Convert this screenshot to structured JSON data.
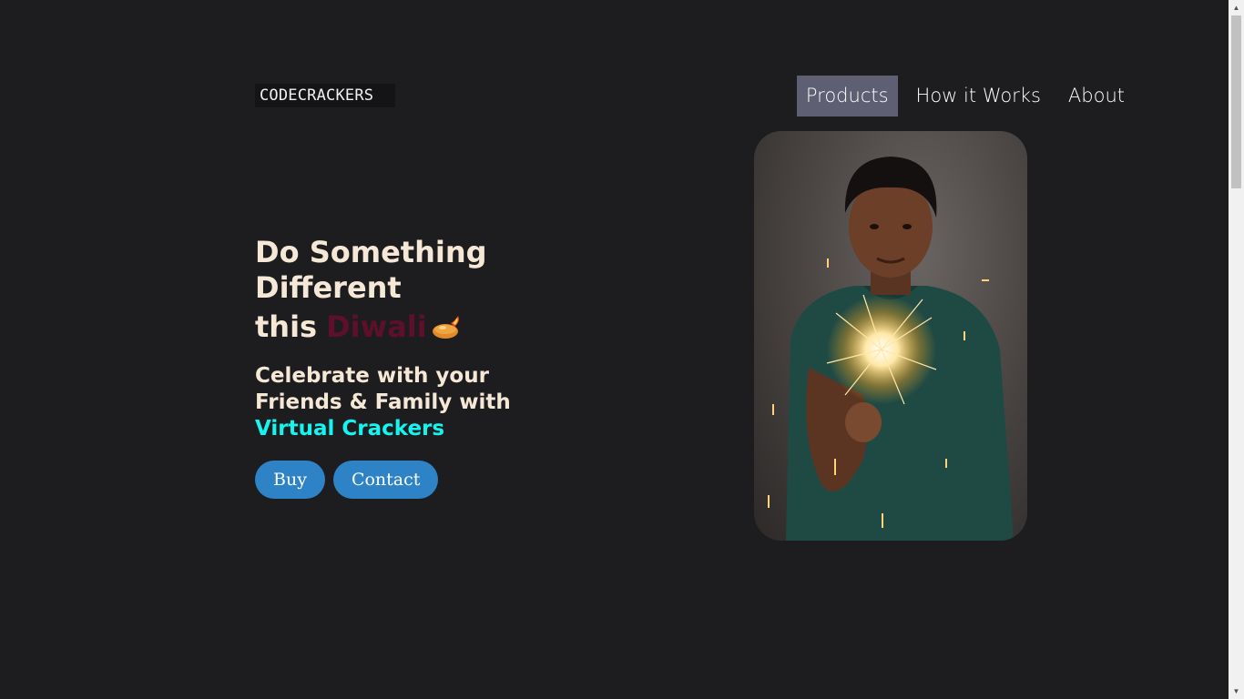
{
  "header": {
    "logo_text": "CODECRACKERS",
    "nav": [
      {
        "label": "Products",
        "active": true
      },
      {
        "label": "How it Works",
        "active": false
      },
      {
        "label": "About",
        "active": false
      }
    ]
  },
  "hero": {
    "title_line1": "Do Something",
    "title_line2": "Different",
    "title_line3_prefix": "this",
    "title_highlight": "Diwali",
    "diya_icon": "diya-lamp-icon",
    "subtitle_line1": "Celebrate with your",
    "subtitle_line2": "Friends & Family with",
    "subtitle_accent": "Virtual Crackers",
    "buttons": {
      "buy": "Buy",
      "contact": "Contact"
    }
  },
  "colors": {
    "background": "#1d1d1f",
    "title": "#f6e8d6",
    "diwali": "#5e0f2a",
    "accent": "#16f4f0",
    "button": "#2e83c6",
    "nav_active": "#5f5f73"
  }
}
